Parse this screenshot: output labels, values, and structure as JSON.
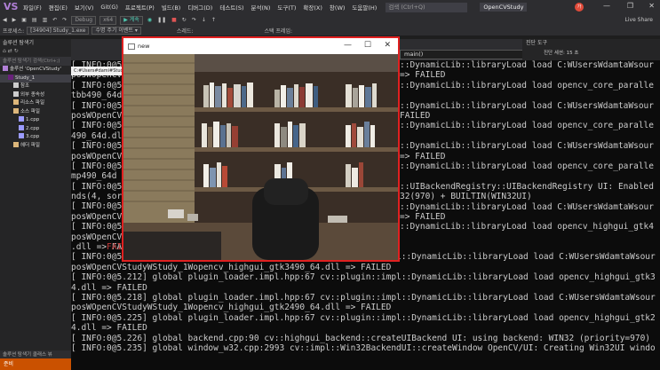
{
  "menubar": {
    "logo": "VS",
    "items": [
      "파일(F)",
      "편집(E)",
      "보기(V)",
      "Git(G)",
      "프로젝트(P)",
      "빌드(B)",
      "디버그(D)",
      "테스트(S)",
      "분석(N)",
      "도구(T)",
      "확장(X)",
      "창(W)",
      "도움말(H)"
    ],
    "search_placeholder": "검색 (Ctrl+Q)",
    "project": "OpenCVStudy",
    "avatar": "가",
    "controls": [
      "—",
      "❐",
      "✕"
    ]
  },
  "toolbar": {
    "config": "Debug",
    "platform": "x64",
    "target": "▶ 계속",
    "right_label": "Live Share"
  },
  "processbar": {
    "label": "프로세스:",
    "process": "[34904] Study_1.exe",
    "lifecycle": "수명 주기 이벤트 ▾",
    "thread_label": "스레드:",
    "stack_label": "스택 프레임:"
  },
  "sidebar": {
    "header": "솔루션 탐색기",
    "search": "솔루션 탐색기 검색(Ctrl+;)",
    "items": [
      {
        "label": "솔루션 'OpenCVStudy'",
        "indent": 0,
        "icon": "solution-icon",
        "color": "#b180d7"
      },
      {
        "label": "Study_1",
        "indent": 1,
        "icon": "project-icon",
        "color": "#68217a",
        "selected": true
      },
      {
        "label": "참조",
        "indent": 2,
        "icon": "references-icon",
        "color": "#ccc"
      },
      {
        "label": "외부 종속성",
        "indent": 2,
        "icon": "external-deps-icon",
        "color": "#ccc"
      },
      {
        "label": "리소스 파일",
        "indent": 2,
        "icon": "folder-icon",
        "color": "#dcb67a"
      },
      {
        "label": "소스 파일",
        "indent": 2,
        "icon": "folder-icon",
        "color": "#dcb67a"
      },
      {
        "label": "1.cpp",
        "indent": 3,
        "icon": "cpp-file-icon",
        "color": "#9b9bff"
      },
      {
        "label": "2.cpp",
        "indent": 3,
        "icon": "cpp-file-icon",
        "color": "#9b9bff"
      },
      {
        "label": "3.cpp",
        "indent": 3,
        "icon": "cpp-file-icon",
        "color": "#9b9bff"
      },
      {
        "label": "헤더 파일",
        "indent": 2,
        "icon": "folder-icon",
        "color": "#dcb67a"
      }
    ],
    "bottom_tabs": "솔루션 탐색기   클래스 뷰"
  },
  "statusbar": {
    "text": "준비"
  },
  "editor": {
    "function_combo": "main()"
  },
  "right_panel": {
    "title": "진단 도구",
    "sub": "진단 세션: 15 초"
  },
  "console_tab": "C:#Users#dami#Study",
  "camera_window": {
    "title": "new"
  },
  "console": {
    "lines": [
      "[ INFO:0@5",
      "posWOpenCV",
      "[ INFO:0@5",
      "tbb490_64d",
      "[ INFO:0@5",
      "posWOpenCV",
      "[ INFO:0@5",
      "490_64d.dl",
      "[ INFO:0@5",
      "posWOpenCV",
      "[ INFO:0@5",
      "mp490_64d",
      "[ INFO:0@5",
      "nds(4, sor",
      "[ INFO:0@5",
      "posWOpenCV",
      "[ INFO:0@5",
      "posWOpenCV",
      ".dll => FAILED",
      "[ INFO:0@5.207] global plugin_loader.impl.hpp:67 cv::plugin::impl::DynamicLib::libraryLoad load C:WUsersWdamtaWsour",
      "posWOpenCVStudyWStudy_1Wopencv_highgui_gtk3490_64.dll => FAILED",
      "[ INFO:0@5.212] global plugin_loader.impl.hpp:67 cv::plugin::impl::DynamicLib::libraryLoad load opencv_highgui_gtk3",
      "4.dll => FAILED",
      "[ INFO:0@5.218] global plugin_loader.impl.hpp:67 cv::plugin::impl::DynamicLib::libraryLoad load C:WUsersWdamtaWsour",
      "posWOpenCVStudyWStudy_1Wopencv_highgui_gtk2490_64.dll => FAILED",
      "[ INFO:0@5.225] global plugin_loader.impl.hpp:67 cv::plugin::impl::DynamicLib::libraryLoad load opencv_highgui_gtk2",
      "4.dll => FAILED",
      "[ INFO:0@5.226] global backend.cpp:90 cv::highgui_backend::createUIBackend UI: using backend: WIN32 (priority=970)",
      "[ INFO:0@5.235] global window_w32.cpp:2993 cv::impl::Win32BackendUI::createWindow OpenCV/UI: Creating Win32UI windo"
    ],
    "right_lines": [
      "::DynamicLib::libraryLoad load C:WUsersWdamtaWsour",
      "=> FAILED",
      "::DynamicLib::libraryLoad load opencv_core_paralle",
      "",
      "::DynamicLib::libraryLoad load C:WUsersWdamtaWsour",
      "FAILED",
      "::DynamicLib::libraryLoad load opencv_core_paralle",
      "",
      "::DynamicLib::libraryLoad load C:WUsersWdamtaWsour",
      "=> FAILED",
      "::DynamicLib::libraryLoad load opencv_core_paralle",
      "",
      "::UIBackendRegistry::UIBackendRegistry UI: Enabled",
      "32(970) + BUILTIN(WIN32UI)",
      "::DynamicLib::libraryLoad load C:WUsersWdamtaWsour",
      "=> FAILED",
      "::DynamicLib::libraryLoad load opencv_highgui_gtk4"
    ],
    "overlap_fragment": "FAILED"
  }
}
